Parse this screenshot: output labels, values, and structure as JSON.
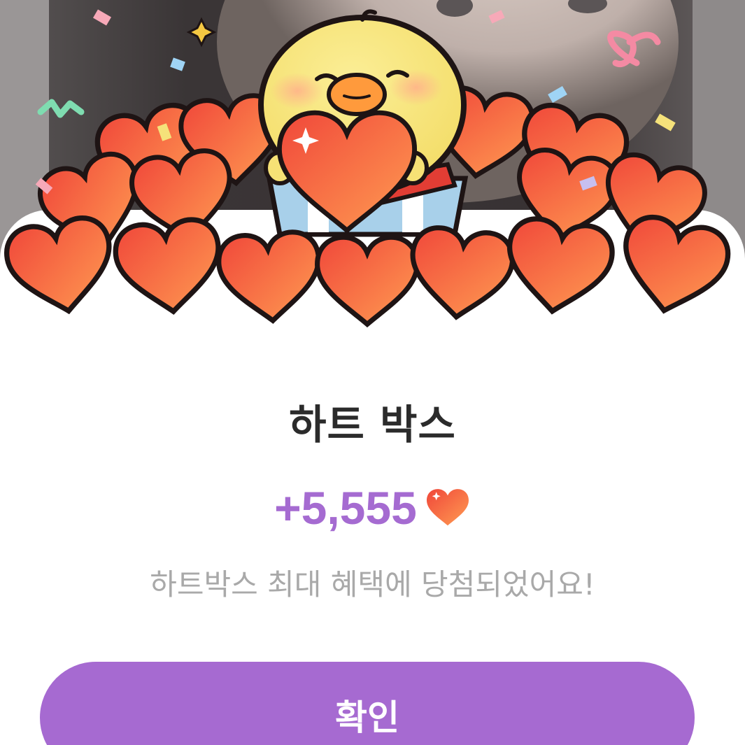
{
  "popup": {
    "title": "하트 박스",
    "reward_amount": "+5,555",
    "reward_icon": "heart-icon",
    "message": "하트박스 최대 혜택에 당첨되었어요!",
    "confirm_label": "확인"
  },
  "illustration": {
    "subject": "chick-holding-heart-icon",
    "decorations": [
      "heart-icon",
      "confetti-icon",
      "sparkle-icon",
      "gift-box-icon"
    ]
  },
  "colors": {
    "accent_purple": "#a66ad1",
    "reward_text": "#a56bd1",
    "title_text": "#2b2b2b",
    "message_text": "#a9a9a9",
    "heart_red": "#f04b3a",
    "heart_orange": "#ff9a4f",
    "chick_yellow": "#f8e47a"
  }
}
